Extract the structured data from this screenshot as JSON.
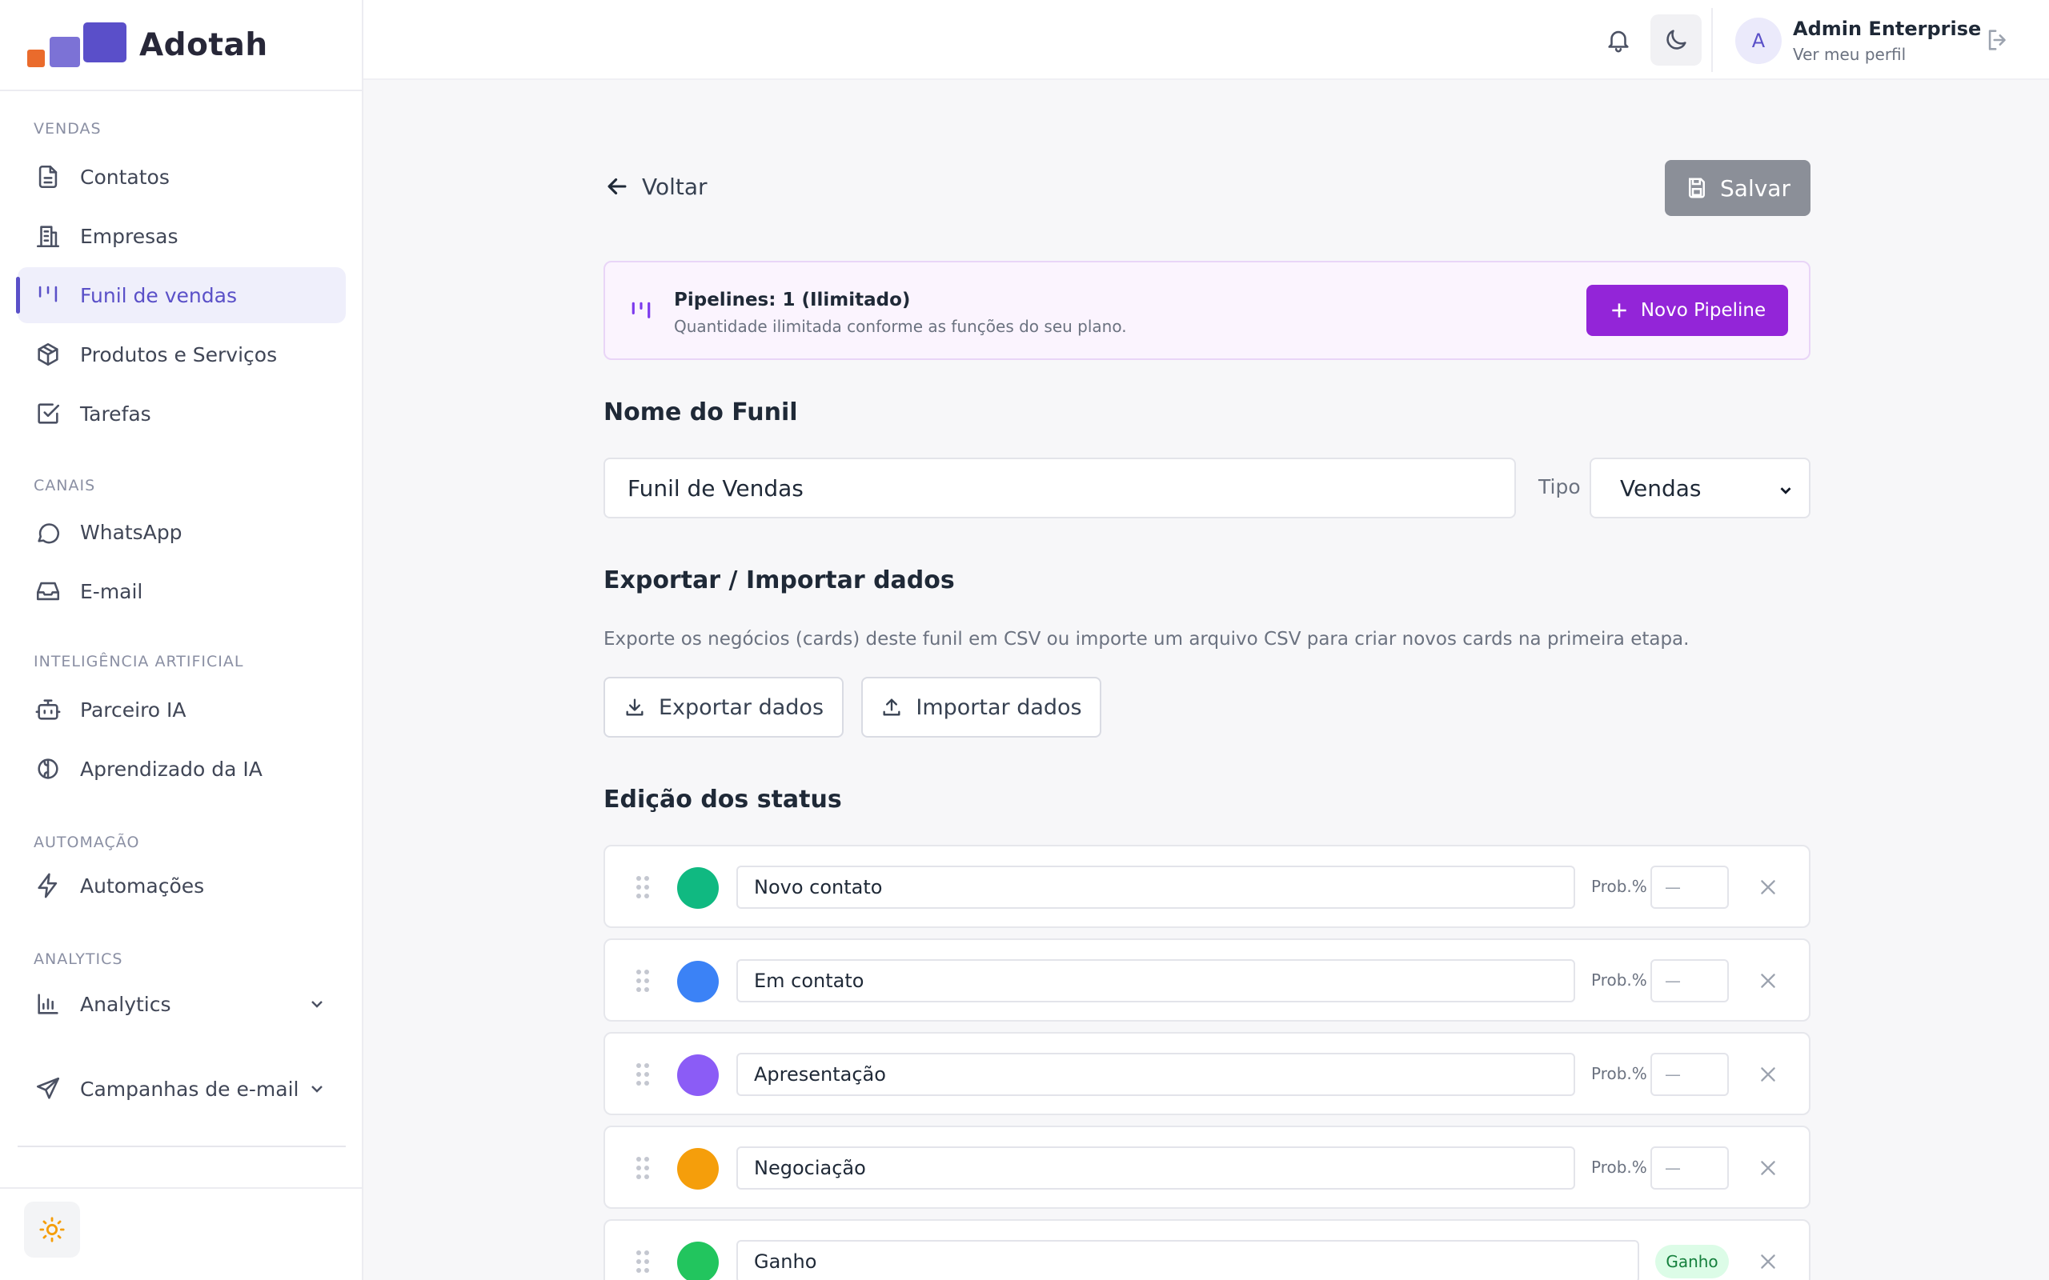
{
  "app": {
    "name": "Adotah"
  },
  "sidebar": {
    "sections": {
      "vendas": "VENDAS",
      "canais": "CANAIS",
      "ia": "INTELIGÊNCIA ARTIFICIAL",
      "automacao": "AUTOMAÇÃO",
      "analytics": "ANALYTICS"
    },
    "items": {
      "contatos": "Contatos",
      "empresas": "Empresas",
      "funil": "Funil de vendas",
      "produtos": "Produtos e Serviços",
      "tarefas": "Tarefas",
      "whatsapp": "WhatsApp",
      "email": "E-mail",
      "parceiro": "Parceiro IA",
      "aprendizado": "Aprendizado da IA",
      "automacoes": "Automações",
      "analytics": "Analytics",
      "campanhas": "Campanhas de e-mail"
    },
    "active_item": "Funil de vendas"
  },
  "header": {
    "user_name": "Admin Enterprise",
    "user_link": "Ver meu perfil",
    "avatar_initial": "A"
  },
  "page": {
    "back_label": "Voltar",
    "save_label": "Salvar",
    "pipelines": {
      "title": "Pipelines: 1 (Ilimitado)",
      "subtitle": "Quantidade ilimitada conforme as funções do seu plano.",
      "new_label": "Novo Pipeline"
    },
    "funnel_name_title": "Nome do Funil",
    "funnel_name_value": "Funil de Vendas",
    "type_label": "Tipo",
    "type_value": "Vendas",
    "export_title": "Exportar / Importar dados",
    "export_desc": "Exporte os negócios (cards) deste funil em CSV ou importe um arquivo CSV para criar novos cards na primeira etapa.",
    "export_label": "Exportar dados",
    "import_label": "Importar dados",
    "status_title": "Edição dos status",
    "prob_label": "Prob.%",
    "prob_placeholder": "—",
    "statuses": [
      {
        "name": "Novo contato",
        "color": "#10b981"
      },
      {
        "name": "Em contato",
        "color": "#3b82f6"
      },
      {
        "name": "Apresentação",
        "color": "#8b5cf6"
      },
      {
        "name": "Negociação",
        "color": "#f59e0b"
      },
      {
        "name": "Ganho",
        "color": "#22c55e",
        "badge": "Ganho"
      }
    ]
  }
}
